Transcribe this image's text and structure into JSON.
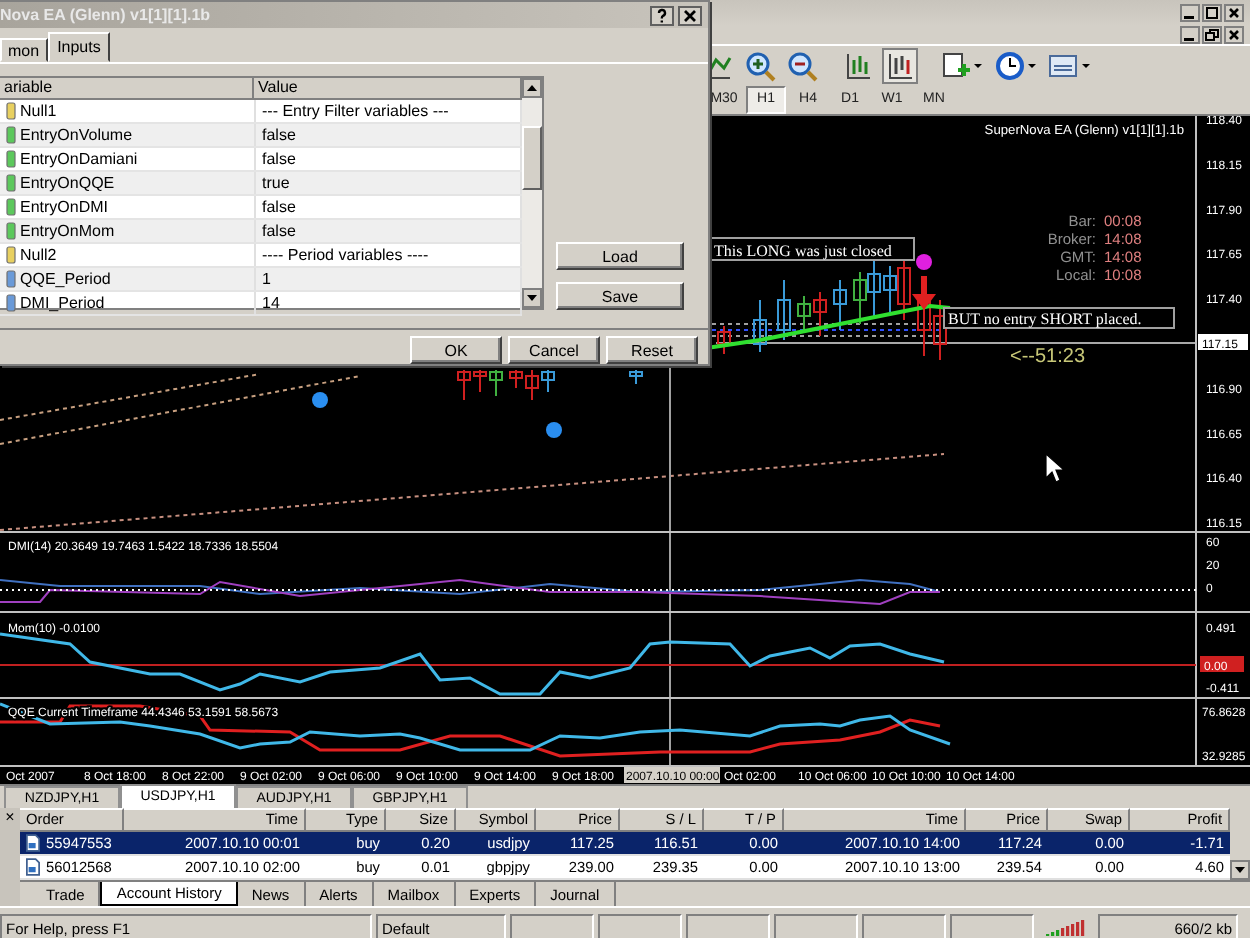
{
  "dialog": {
    "title": "Nova EA (Glenn) v1[1][1].1b",
    "tabs": [
      {
        "label": "mon",
        "selected": false
      },
      {
        "label": "Inputs",
        "selected": true
      }
    ],
    "columns": [
      "ariable",
      "Value"
    ],
    "rows": [
      {
        "variable": "Null1",
        "value": "--- Entry Filter variables ---",
        "kind": "text"
      },
      {
        "variable": "EntryOnVolume",
        "value": "false",
        "kind": "bool"
      },
      {
        "variable": "EntryOnDamiani",
        "value": "false",
        "kind": "bool"
      },
      {
        "variable": "EntryOnQQE",
        "value": "true",
        "kind": "bool"
      },
      {
        "variable": "EntryOnDMI",
        "value": "false",
        "kind": "bool"
      },
      {
        "variable": "EntryOnMom",
        "value": "false",
        "kind": "bool"
      },
      {
        "variable": "Null2",
        "value": "---- Period variables ----",
        "kind": "text"
      },
      {
        "variable": "QQE_Period",
        "value": "1",
        "kind": "int"
      },
      {
        "variable": "DMI_Period",
        "value": "14",
        "kind": "int"
      }
    ],
    "side_buttons": [
      "Load",
      "Save"
    ],
    "buttons": [
      "OK",
      "Cancel",
      "Reset"
    ]
  },
  "timeframes": [
    {
      "label": "M30",
      "selected": false
    },
    {
      "label": "H1",
      "selected": true
    },
    {
      "label": "H4",
      "selected": false
    },
    {
      "label": "D1",
      "selected": false
    },
    {
      "label": "W1",
      "selected": false
    },
    {
      "label": "MN",
      "selected": false
    }
  ],
  "chart": {
    "title": "SuperNova EA (Glenn) v1[1][1].1b",
    "price_ticks": [
      "118.40",
      "118.15",
      "117.90",
      "117.65",
      "117.40",
      "116.90",
      "116.65",
      "116.40",
      "116.15"
    ],
    "current_price": "117.15",
    "clock": [
      {
        "label": "Bar:",
        "value": "00:08"
      },
      {
        "label": "Broker:",
        "value": "14:08"
      },
      {
        "label": "GMT:",
        "value": "14:08"
      },
      {
        "label": "Local:",
        "value": "10:08"
      }
    ],
    "annotations": [
      "This LONG was just closed",
      "BUT no entry SHORT placed."
    ],
    "countdown": "<--51:23",
    "time_labels": [
      "Oct 2007",
      "8 Oct 18:00",
      "8 Oct 22:00",
      "9 Oct 02:00",
      "9 Oct 06:00",
      "9 Oct 10:00",
      "9 Oct 14:00",
      "9 Oct 18:00",
      "Oct 02:00",
      "10 Oct 06:00",
      "10 Oct 10:00",
      "10 Oct 14:00"
    ],
    "time_cursor": "2007.10.10 00:00"
  },
  "indicators": [
    {
      "title": "DMI(14) 20.3649 19.7463 1.5422 18.7336 18.5504",
      "ticks": [
        "60",
        "20",
        "0"
      ]
    },
    {
      "title": "Mom(10) -0.0100",
      "ticks": [
        "0.491",
        "-0.411"
      ],
      "zero": "0.00"
    },
    {
      "title": "QQE Current Timeframe 44.4346 53.1591 58.5673",
      "ticks": [
        "76.8628",
        "32.9285"
      ]
    }
  ],
  "chart_tabs": [
    {
      "label": "NZDJPY,H1",
      "selected": false
    },
    {
      "label": "USDJPY,H1",
      "selected": true
    },
    {
      "label": "AUDJPY,H1",
      "selected": false
    },
    {
      "label": "GBPJPY,H1",
      "selected": false
    }
  ],
  "terminal": {
    "close": "×",
    "columns": [
      "Order",
      "Time",
      "Type",
      "Size",
      "Symbol",
      "Price",
      "S / L",
      "T / P",
      "Time",
      "Price",
      "Swap",
      "Profit"
    ],
    "rows": [
      {
        "cells": [
          "55947553",
          "2007.10.10 00:01",
          "buy",
          "0.20",
          "usdjpy",
          "117.25",
          "116.51",
          "0.00",
          "2007.10.10 14:00",
          "117.24",
          "0.00",
          "-1.71"
        ],
        "selected": true
      },
      {
        "cells": [
          "56012568",
          "2007.10.10 02:00",
          "buy",
          "0.01",
          "gbpjpy",
          "239.00",
          "239.35",
          "0.00",
          "2007.10.10 13:00",
          "239.54",
          "0.00",
          "4.60"
        ],
        "selected": false
      }
    ],
    "tabs": [
      {
        "label": "Trade",
        "selected": false
      },
      {
        "label": "Account History",
        "selected": true
      },
      {
        "label": "News",
        "selected": false
      },
      {
        "label": "Alerts",
        "selected": false
      },
      {
        "label": "Mailbox",
        "selected": false
      },
      {
        "label": "Experts",
        "selected": false
      },
      {
        "label": "Journal",
        "selected": false
      }
    ]
  },
  "status_bar": [
    "For Help, press F1",
    "Default",
    "660/2 kb"
  ]
}
